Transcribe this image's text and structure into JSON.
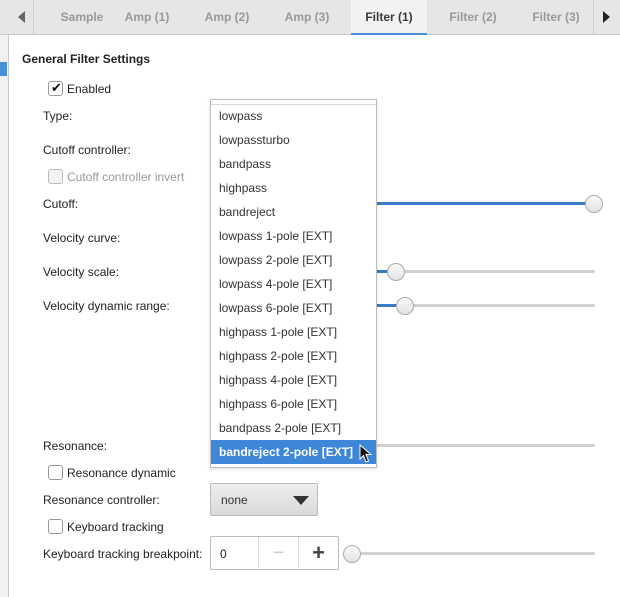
{
  "tabs": [
    {
      "label": "Sample",
      "active": false
    },
    {
      "label": "Amp (1)",
      "active": false
    },
    {
      "label": "Amp (2)",
      "active": false
    },
    {
      "label": "Amp (3)",
      "active": false
    },
    {
      "label": "Filter (1)",
      "active": true
    },
    {
      "label": "Filter (2)",
      "active": false
    },
    {
      "label": "Filter (3)",
      "active": false
    }
  ],
  "section_title": "General Filter Settings",
  "enabled": {
    "label": "Enabled",
    "checked": true
  },
  "type": {
    "label": "Type:",
    "options": [
      "lowpass",
      "lowpassturbo",
      "bandpass",
      "highpass",
      "bandreject",
      "lowpass 1-pole [EXT]",
      "lowpass 2-pole [EXT]",
      "lowpass 4-pole [EXT]",
      "lowpass 6-pole [EXT]",
      "highpass 1-pole [EXT]",
      "highpass 2-pole [EXT]",
      "highpass 4-pole [EXT]",
      "highpass 6-pole [EXT]",
      "bandpass 2-pole [EXT]",
      "bandreject 2-pole [EXT]"
    ],
    "highlighted": "bandreject 2-pole [EXT]"
  },
  "cutoff_controller": {
    "label": "Cutoff controller:"
  },
  "cutoff_invert": {
    "label": "Cutoff controller invert",
    "checked": false,
    "disabled": true
  },
  "cutoff": {
    "label": "Cutoff:",
    "level": 1.0
  },
  "velocity_curve": {
    "label": "Velocity curve:"
  },
  "velocity_scale": {
    "label": "Velocity scale:",
    "level": 0.18
  },
  "velocity_range": {
    "label": "Velocity dynamic range:",
    "level": 0.22
  },
  "resonance": {
    "label": "Resonance:"
  },
  "resonance_dynamic": {
    "label": "Resonance dynamic",
    "checked": false
  },
  "resonance_controller": {
    "label": "Resonance controller:",
    "value": "none"
  },
  "keyboard_tracking": {
    "label": "Keyboard tracking",
    "checked": false
  },
  "kt_breakpoint": {
    "label": "Keyboard tracking breakpoint:",
    "value": "0",
    "minus": "−",
    "plus": "+",
    "level": 0.0
  },
  "colors": {
    "accent": "#3d86d8",
    "slider_fill": "#3a78c8"
  }
}
